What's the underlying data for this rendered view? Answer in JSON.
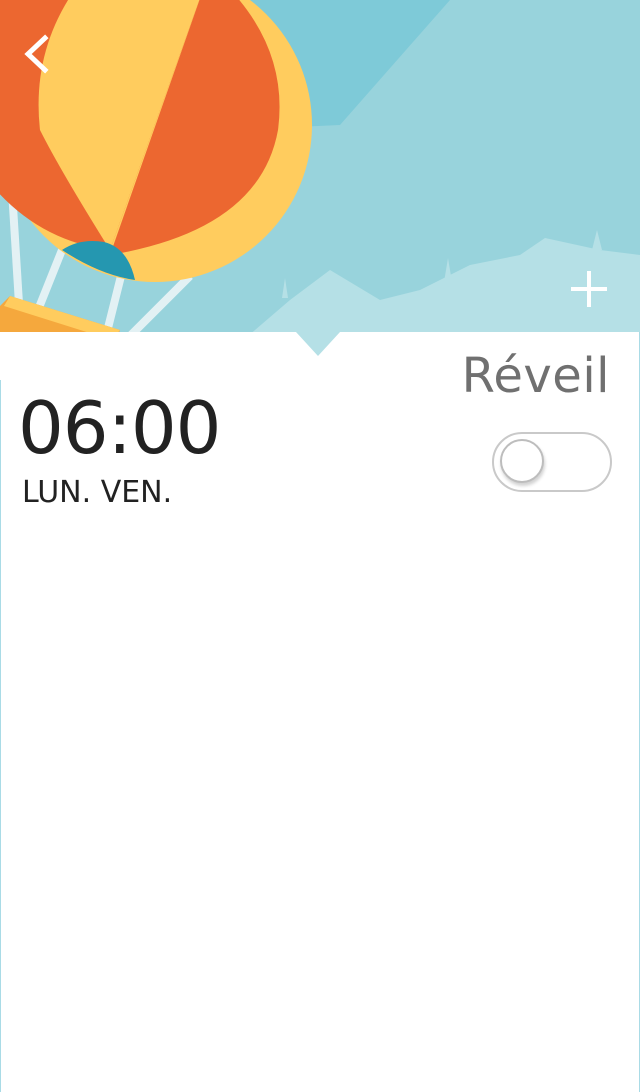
{
  "header": {
    "back_icon": "chevron-left-icon",
    "add_icon": "plus-icon",
    "title": "Réveil"
  },
  "alarms": [
    {
      "time": "06:00",
      "days": "LUN. VEN.",
      "enabled": false
    }
  ],
  "colors": {
    "sky": "#7ecad8",
    "mountains": "#9ad3dc",
    "balloon_orange": "#ec6730",
    "balloon_yellow": "#ffcc5e",
    "balloon_teal": "#2597b0",
    "title_text": "#707070",
    "time_text": "#222222",
    "toggle_border": "#c9c9c9",
    "panel": "#ffffff"
  }
}
